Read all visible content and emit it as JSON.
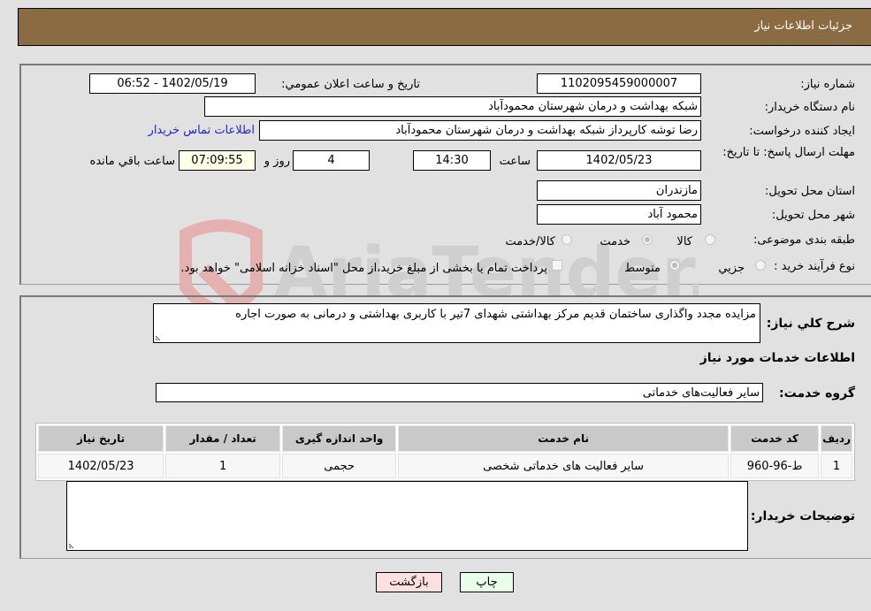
{
  "header": {
    "title": "جزئیات اطلاعات نیاز"
  },
  "details": {
    "need_number": {
      "label": "شماره نیاز:",
      "value": "1102095459000007"
    },
    "announce_datetime": {
      "label": "تاریخ و ساعت اعلان عمومي:",
      "value": "1402/05/19 - 06:52"
    },
    "buyer_org": {
      "label": "نام دستگاه خریدار:",
      "value": "شبکه بهداشت و درمان شهرستان محمودآباد"
    },
    "requester": {
      "label": "ایجاد کننده درخواست:",
      "value": "رضا توشه کارپرداز شبکه بهداشت و درمان شهرستان محمودآباد"
    },
    "buyer_contact_link": "اطلاعات تماس خریدار",
    "deadline": {
      "label": "مهلت ارسال پاسخ: تا تاریخ:",
      "date": "1402/05/23",
      "time_label": "ساعت",
      "time": "14:30",
      "days": "4",
      "days_label": "روز و",
      "remaining": "07:09:55",
      "remaining_label": "ساعت باقي مانده"
    },
    "province": {
      "label": "استان محل تحویل:",
      "value": "مازندران"
    },
    "city": {
      "label": "شهر محل تحویل:",
      "value": "محمود آباد"
    },
    "category": {
      "label": "طبقه بندی موضوعی:",
      "options": [
        {
          "label": "کالا",
          "selected": false
        },
        {
          "label": "خدمت",
          "selected": true
        },
        {
          "label": "کالا/خدمت",
          "selected": false
        }
      ]
    },
    "purchase_process": {
      "label": "نوع فرآیند خرید :",
      "options": [
        {
          "label": "جزيي",
          "selected": false
        },
        {
          "label": "متوسط",
          "selected": true
        }
      ],
      "treasury_note": "پرداخت تمام یا بخشی از مبلغ خرید،از محل \"اسناد خزانه اسلامی\" خواهد بود.",
      "treasury_checked": false
    }
  },
  "summary": {
    "label": "شرح کلي نیاز:",
    "value": "مزایده مجدد واگذاری ساختمان قدیم مرکز بهداشتی شهدای 7تیر با کاربری بهداشتی و درمانی به صورت اجاره"
  },
  "services": {
    "section_title": "اطلاعات خدمات مورد نیاز",
    "group_label": "گروه خدمت:",
    "group_value": "سایر فعالیت‌های خدماتی",
    "table": {
      "columns": [
        "ردیف",
        "کد خدمت",
        "نام خدمت",
        "واحد اندازه گیری",
        "تعداد / مقدار",
        "تاریخ نیاز"
      ],
      "rows": [
        [
          "1",
          "ط-96-960",
          "سایر فعالیت های خدماتی شخصی",
          "حجمی",
          "1",
          "1402/05/23"
        ]
      ]
    }
  },
  "buyer_notes": {
    "label": "توضیحات خریدار:",
    "value": ""
  },
  "buttons": {
    "print": "چاپ",
    "back": "بازگشت"
  },
  "watermark": {
    "text": "AriaTender.neT"
  },
  "colors": {
    "header_bg": "#8b6c42",
    "link": "#1f24d0",
    "remaining_bg": "#ffffe8",
    "back_bg": "#ffe0e0",
    "print_bg": "#eaffea"
  }
}
